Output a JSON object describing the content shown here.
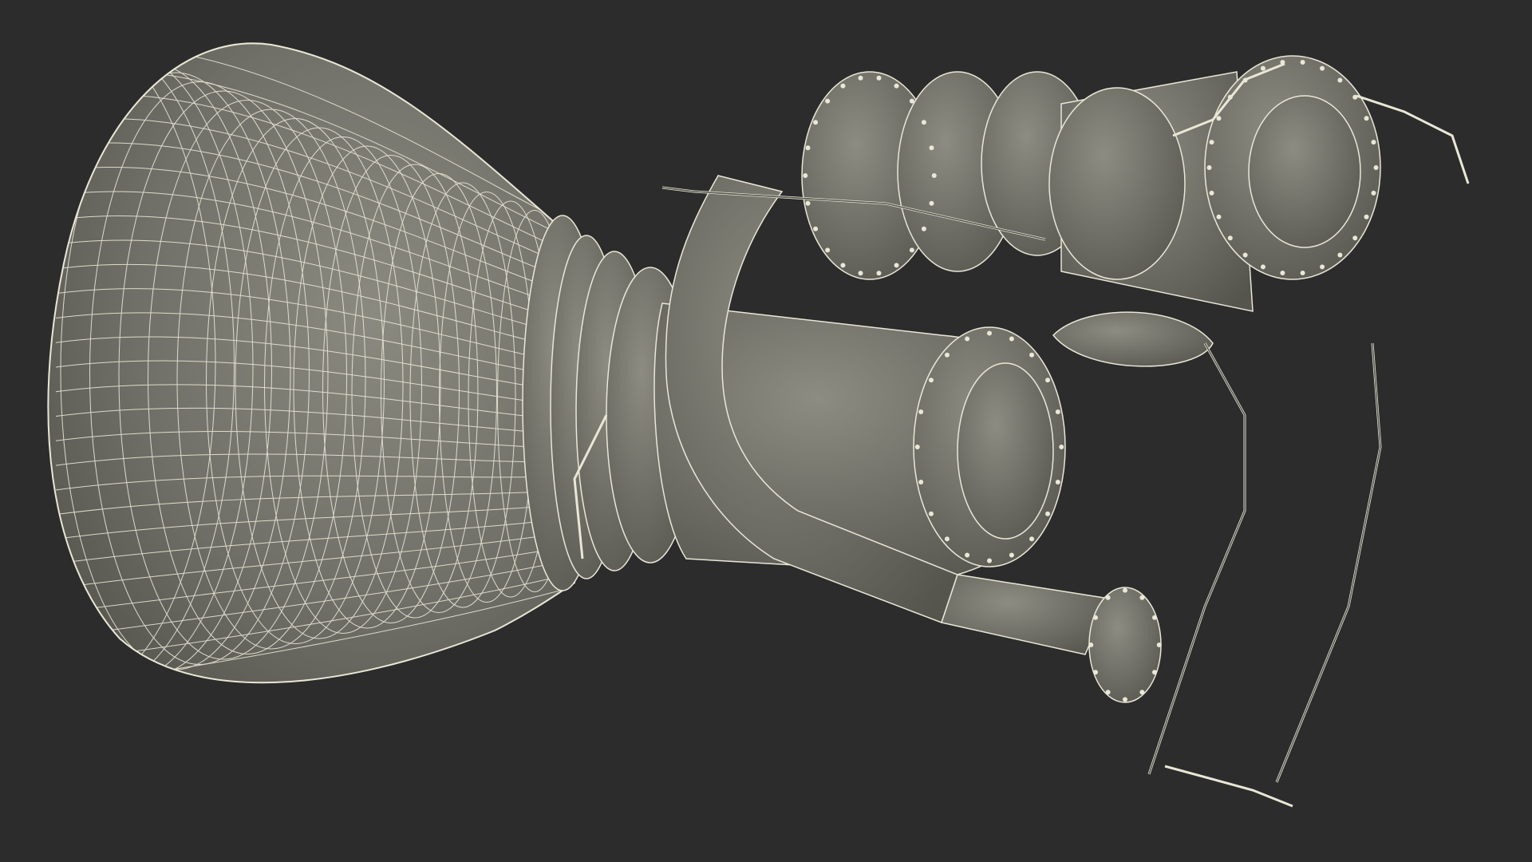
{
  "scene": {
    "subject": "rocket-engine-wireframe",
    "background_color": "#2c2c2c",
    "surface_color": "#77776e",
    "wire_color": "#e9e7d6",
    "shadow_color": "#4a4a44"
  }
}
